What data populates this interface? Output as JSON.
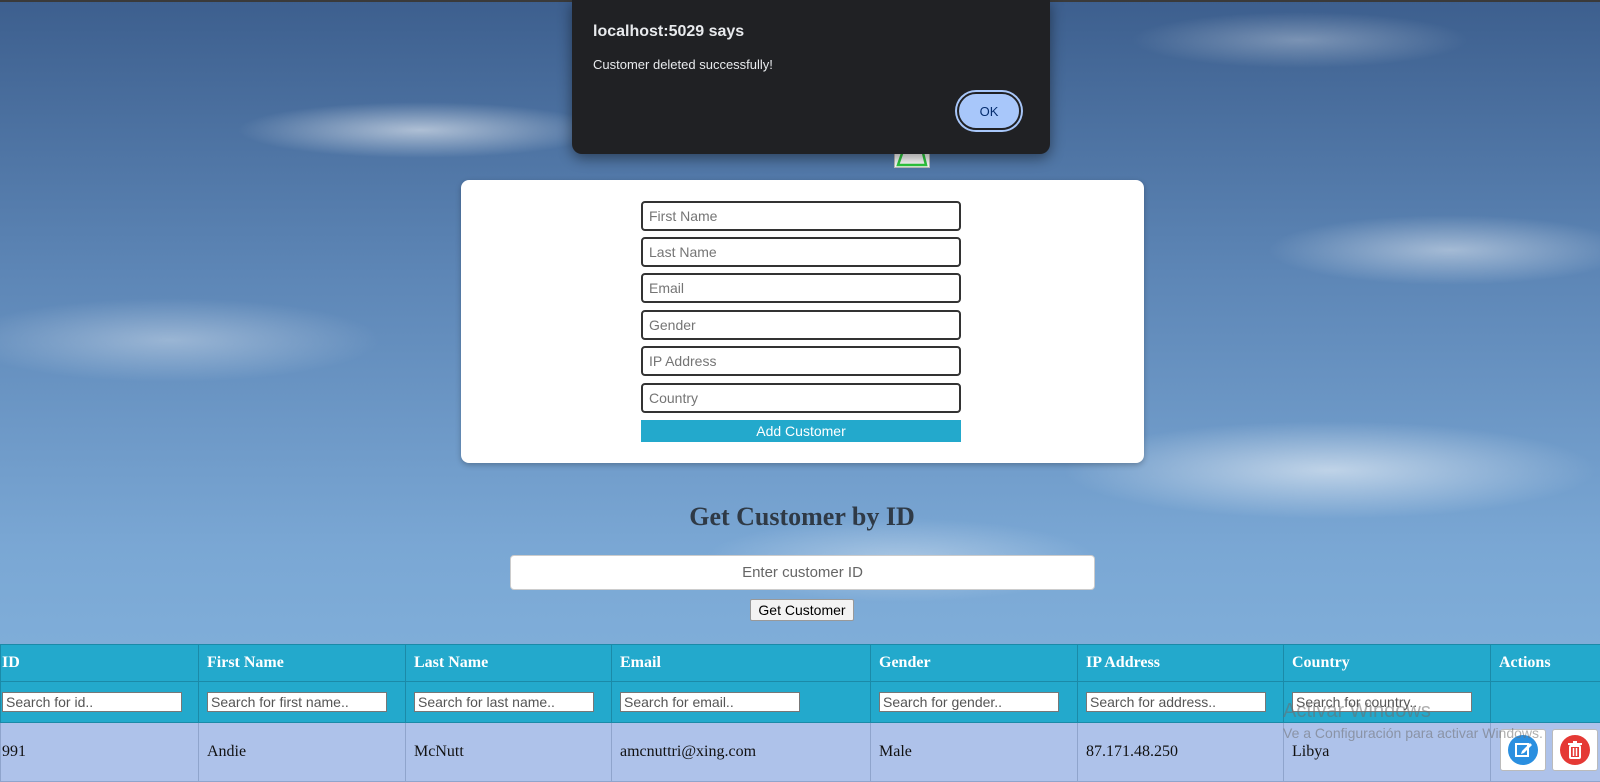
{
  "dialog": {
    "title": "localhost:5029 says",
    "message": "Customer deleted successfully!",
    "ok_label": "OK"
  },
  "add_form": {
    "first_name_placeholder": "First Name",
    "last_name_placeholder": "Last Name",
    "email_placeholder": "Email",
    "gender_placeholder": "Gender",
    "ip_placeholder": "IP Address",
    "country_placeholder": "Country",
    "submit_label": "Add Customer"
  },
  "get_by_id": {
    "title": "Get Customer by ID",
    "input_placeholder": "Enter customer ID",
    "button_label": "Get Customer"
  },
  "table": {
    "headers": [
      "ID",
      "First Name",
      "Last Name",
      "Email",
      "Gender",
      "IP Address",
      "Country",
      "Actions"
    ],
    "filter_placeholders": [
      "Search for id..",
      "Search for first name..",
      "Search for last name..",
      "Search for email..",
      "Search for gender..",
      "Search for address..",
      "Search for country.."
    ],
    "rows": [
      {
        "id": "991",
        "first_name": "Andie",
        "last_name": "McNutt",
        "email": "amcnuttri@xing.com",
        "gender": "Male",
        "ip": "87.171.48.250",
        "country": "Libya"
      }
    ],
    "actions": {
      "edit_icon": "edit-icon",
      "delete_icon": "trash-icon"
    }
  },
  "watermark": {
    "title": "Activar Windows",
    "subtitle": "Ve a Configuración para activar Windows."
  },
  "colors": {
    "header_bg": "#23a9cc",
    "row_bg": "#aec2ea",
    "dialog_bg": "#202124",
    "dialog_button": "#a8c7fa",
    "edit_icon": "#2a8fe0",
    "delete_icon": "#e53935"
  }
}
